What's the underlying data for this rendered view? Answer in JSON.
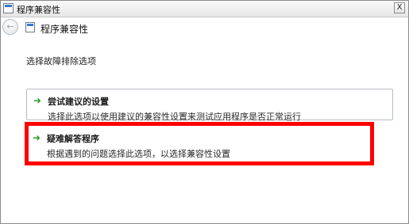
{
  "window": {
    "title": "程序兼容性",
    "close_label": "X"
  },
  "nav": {
    "back_glyph": "←",
    "title": "程序兼容性"
  },
  "content": {
    "prompt": "选择故障排除选项",
    "options": [
      {
        "icon": "green-arrow-icon",
        "title": "尝试建议的设置",
        "description": "选择此选项以使用建议的兼容性设置来测试应用程序是否正常运行"
      },
      {
        "icon": "green-arrow-icon",
        "title": "疑难解答程序",
        "description": "根据遇到的问题选择此选项，以选择兼容性设置"
      }
    ]
  },
  "colors": {
    "highlight": "#ff0000",
    "arrow": "#2c9b2c"
  }
}
